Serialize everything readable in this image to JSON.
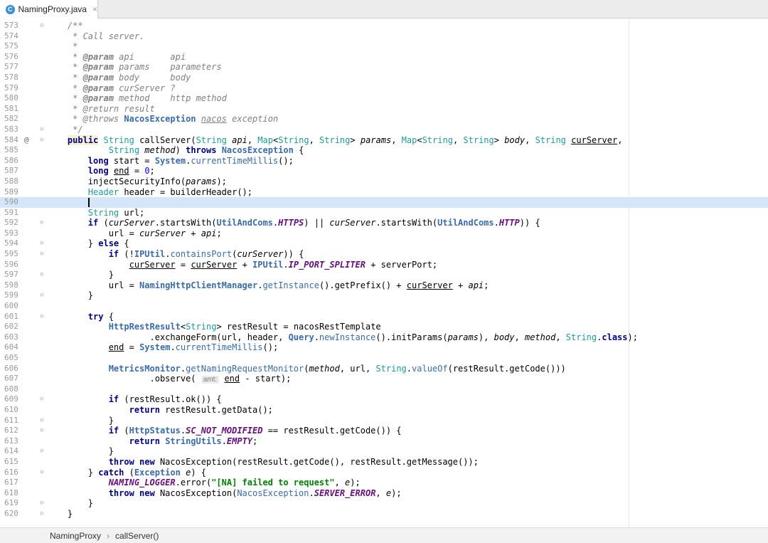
{
  "tab": {
    "filename": "NamingProxy.java",
    "icon_letter": "C",
    "close": "×"
  },
  "breadcrumb": {
    "items": [
      "NamingProxy",
      "callServer()"
    ],
    "separator": "›"
  },
  "editor": {
    "current_line": "590",
    "gutter_marker": "@"
  },
  "code_lines": [
    {
      "n": "573",
      "fold": "⊖",
      "segs": [
        [
          "",
          "    "
        ],
        [
          "cm",
          "/**"
        ]
      ]
    },
    {
      "n": "574",
      "segs": [
        [
          "cm",
          "     * Call server."
        ]
      ]
    },
    {
      "n": "575",
      "segs": [
        [
          "cm",
          "     *"
        ]
      ]
    },
    {
      "n": "576",
      "segs": [
        [
          "cm",
          "     * "
        ],
        [
          "jd",
          "@param"
        ],
        [
          "cm",
          " api       api"
        ]
      ]
    },
    {
      "n": "577",
      "segs": [
        [
          "cm",
          "     * "
        ],
        [
          "jd",
          "@param"
        ],
        [
          "cm",
          " params    parameters"
        ]
      ]
    },
    {
      "n": "578",
      "segs": [
        [
          "cm",
          "     * "
        ],
        [
          "jd",
          "@param"
        ],
        [
          "cm",
          " body      body"
        ]
      ]
    },
    {
      "n": "579",
      "segs": [
        [
          "cm",
          "     * "
        ],
        [
          "jd",
          "@param"
        ],
        [
          "cm",
          " curServer ?"
        ]
      ]
    },
    {
      "n": "580",
      "segs": [
        [
          "cm",
          "     * "
        ],
        [
          "jd",
          "@param"
        ],
        [
          "cm",
          " method    http method"
        ]
      ]
    },
    {
      "n": "581",
      "segs": [
        [
          "cm",
          "     * @return result"
        ]
      ]
    },
    {
      "n": "582",
      "segs": [
        [
          "cm",
          "     * @throws "
        ],
        [
          "cl",
          "NacosException"
        ],
        [
          "cm",
          " "
        ],
        [
          "cm ul",
          "nacos"
        ],
        [
          "cm",
          " exception"
        ]
      ]
    },
    {
      "n": "583",
      "fold": "⊖",
      "segs": [
        [
          "cm",
          "     */"
        ]
      ]
    },
    {
      "n": "584",
      "mk": "@",
      "fold": "⊖",
      "segs": [
        [
          "",
          "    "
        ],
        [
          "kw ann",
          "public"
        ],
        [
          "",
          " "
        ],
        [
          "ty",
          "String"
        ],
        [
          "",
          " callServer("
        ],
        [
          "ty",
          "String"
        ],
        [
          "",
          " "
        ],
        [
          "pa",
          "api"
        ],
        [
          "",
          ", "
        ],
        [
          "ty",
          "Map"
        ],
        [
          "",
          "<"
        ],
        [
          "ty",
          "String"
        ],
        [
          "",
          ", "
        ],
        [
          "ty",
          "String"
        ],
        [
          "",
          "> "
        ],
        [
          "pa",
          "params"
        ],
        [
          "",
          ", "
        ],
        [
          "ty",
          "Map"
        ],
        [
          "",
          "<"
        ],
        [
          "ty",
          "String"
        ],
        [
          "",
          ", "
        ],
        [
          "ty",
          "String"
        ],
        [
          "",
          "> "
        ],
        [
          "pa",
          "body"
        ],
        [
          "",
          ", "
        ],
        [
          "ty",
          "String"
        ],
        [
          "",
          " "
        ],
        [
          "ul",
          "curServer"
        ],
        [
          "",
          ","
        ]
      ]
    },
    {
      "n": "585",
      "segs": [
        [
          "",
          "            "
        ],
        [
          "ty",
          "String"
        ],
        [
          "",
          " "
        ],
        [
          "pa",
          "method"
        ],
        [
          "",
          ") "
        ],
        [
          "kw",
          "throws"
        ],
        [
          "",
          " "
        ],
        [
          "cl",
          "NacosException"
        ],
        [
          "",
          " {"
        ]
      ]
    },
    {
      "n": "586",
      "segs": [
        [
          "",
          "        "
        ],
        [
          "kw",
          "long"
        ],
        [
          "",
          " start = "
        ],
        [
          "cl",
          "System"
        ],
        [
          "",
          "."
        ],
        [
          "fn",
          "currentTimeMillis"
        ],
        [
          "",
          "();"
        ]
      ]
    },
    {
      "n": "587",
      "segs": [
        [
          "",
          "        "
        ],
        [
          "kw",
          "long"
        ],
        [
          "",
          " "
        ],
        [
          "ul",
          "end"
        ],
        [
          "",
          " = "
        ],
        [
          "num",
          "0"
        ],
        [
          "",
          ";"
        ]
      ]
    },
    {
      "n": "588",
      "segs": [
        [
          "",
          "        injectSecurityInfo("
        ],
        [
          "pa",
          "params"
        ],
        [
          "",
          ");"
        ]
      ]
    },
    {
      "n": "589",
      "segs": [
        [
          "",
          "        "
        ],
        [
          "ty",
          "Header"
        ],
        [
          "",
          " header = builderHeader();"
        ]
      ]
    },
    {
      "n": "590",
      "current": true,
      "segs": [
        [
          "",
          "        "
        ],
        [
          "cursor",
          ""
        ]
      ]
    },
    {
      "n": "591",
      "segs": [
        [
          "",
          "        "
        ],
        [
          "ty",
          "String"
        ],
        [
          "",
          " url;"
        ]
      ]
    },
    {
      "n": "592",
      "fold": "⊖",
      "segs": [
        [
          "",
          "        "
        ],
        [
          "kw",
          "if"
        ],
        [
          "",
          " ("
        ],
        [
          "pa",
          "curServer"
        ],
        [
          "",
          ".startsWith("
        ],
        [
          "cl",
          "UtilAndComs"
        ],
        [
          "",
          "."
        ],
        [
          "st",
          "HTTPS"
        ],
        [
          "",
          ") || "
        ],
        [
          "pa",
          "curServer"
        ],
        [
          "",
          ".startsWith("
        ],
        [
          "cl",
          "UtilAndComs"
        ],
        [
          "",
          "."
        ],
        [
          "st",
          "HTTP"
        ],
        [
          "",
          ")) {"
        ]
      ]
    },
    {
      "n": "593",
      "segs": [
        [
          "",
          "            url = "
        ],
        [
          "pa",
          "curServer"
        ],
        [
          "",
          " + "
        ],
        [
          "pa",
          "api"
        ],
        [
          "",
          ";"
        ]
      ]
    },
    {
      "n": "594",
      "fold": "⊖",
      "segs": [
        [
          "",
          "        } "
        ],
        [
          "kw",
          "else"
        ],
        [
          "",
          " {"
        ]
      ]
    },
    {
      "n": "595",
      "fold": "⊖",
      "segs": [
        [
          "",
          "            "
        ],
        [
          "kw",
          "if"
        ],
        [
          "",
          " (!"
        ],
        [
          "cl",
          "IPUtil"
        ],
        [
          "",
          "."
        ],
        [
          "fn",
          "containsPort"
        ],
        [
          "",
          "("
        ],
        [
          "pa",
          "curServer"
        ],
        [
          "",
          ")) {"
        ]
      ]
    },
    {
      "n": "596",
      "segs": [
        [
          "",
          "                "
        ],
        [
          "ul",
          "curServer"
        ],
        [
          "",
          " = "
        ],
        [
          "ul",
          "curServer"
        ],
        [
          "",
          " + "
        ],
        [
          "cl",
          "IPUtil"
        ],
        [
          "",
          "."
        ],
        [
          "st",
          "IP_PORT_SPLITER"
        ],
        [
          "",
          " + serverPort;"
        ]
      ]
    },
    {
      "n": "597",
      "fold": "⊖",
      "segs": [
        [
          "",
          "            }"
        ]
      ]
    },
    {
      "n": "598",
      "segs": [
        [
          "",
          "            url = "
        ],
        [
          "cl",
          "NamingHttpClientManager"
        ],
        [
          "",
          "."
        ],
        [
          "fn",
          "getInstance"
        ],
        [
          "",
          "().getPrefix() + "
        ],
        [
          "ul",
          "curServer"
        ],
        [
          "",
          " + "
        ],
        [
          "pa",
          "api"
        ],
        [
          "",
          ";"
        ]
      ]
    },
    {
      "n": "599",
      "fold": "⊖",
      "segs": [
        [
          "",
          "        }"
        ]
      ]
    },
    {
      "n": "600",
      "segs": [
        [
          "",
          ""
        ]
      ]
    },
    {
      "n": "601",
      "fold": "⊖",
      "segs": [
        [
          "",
          "        "
        ],
        [
          "kw",
          "try"
        ],
        [
          "",
          " {"
        ]
      ]
    },
    {
      "n": "602",
      "segs": [
        [
          "",
          "            "
        ],
        [
          "cl",
          "HttpRestResult"
        ],
        [
          "",
          "<"
        ],
        [
          "ty",
          "String"
        ],
        [
          "",
          "> restResult = nacosRestTemplate"
        ]
      ]
    },
    {
      "n": "603",
      "segs": [
        [
          "",
          "                    .exchangeForm(url, header, "
        ],
        [
          "cl",
          "Query"
        ],
        [
          "",
          "."
        ],
        [
          "fn",
          "newInstance"
        ],
        [
          "",
          "().initParams("
        ],
        [
          "pa",
          "params"
        ],
        [
          "",
          "), "
        ],
        [
          "pa",
          "body"
        ],
        [
          "",
          ", "
        ],
        [
          "pa",
          "method"
        ],
        [
          "",
          ", "
        ],
        [
          "ty",
          "String"
        ],
        [
          "",
          "."
        ],
        [
          "kw",
          "class"
        ],
        [
          "",
          ");"
        ]
      ]
    },
    {
      "n": "604",
      "segs": [
        [
          "",
          "            "
        ],
        [
          "ul",
          "end"
        ],
        [
          "",
          " = "
        ],
        [
          "cl",
          "System"
        ],
        [
          "",
          "."
        ],
        [
          "fn",
          "currentTimeMillis"
        ],
        [
          "",
          "();"
        ]
      ]
    },
    {
      "n": "605",
      "segs": [
        [
          "",
          ""
        ]
      ]
    },
    {
      "n": "606",
      "segs": [
        [
          "",
          "            "
        ],
        [
          "cl",
          "MetricsMonitor"
        ],
        [
          "",
          "."
        ],
        [
          "fn",
          "getNamingRequestMonitor"
        ],
        [
          "",
          "("
        ],
        [
          "pa",
          "method"
        ],
        [
          "",
          ", url, "
        ],
        [
          "ty",
          "String"
        ],
        [
          "",
          "."
        ],
        [
          "fn",
          "valueOf"
        ],
        [
          "",
          "(restResult.getCode()))"
        ]
      ]
    },
    {
      "n": "607",
      "segs": [
        [
          "",
          "                    .observe( "
        ],
        [
          "hint",
          "amt:"
        ],
        [
          "",
          " "
        ],
        [
          "ul",
          "end"
        ],
        [
          "",
          " - start);"
        ]
      ]
    },
    {
      "n": "608",
      "segs": [
        [
          "",
          ""
        ]
      ]
    },
    {
      "n": "609",
      "fold": "⊖",
      "segs": [
        [
          "",
          "            "
        ],
        [
          "kw",
          "if"
        ],
        [
          "",
          " (restResult.ok()) {"
        ]
      ]
    },
    {
      "n": "610",
      "segs": [
        [
          "",
          "                "
        ],
        [
          "kw",
          "return"
        ],
        [
          "",
          " restResult.getData();"
        ]
      ]
    },
    {
      "n": "611",
      "fold": "⊖",
      "segs": [
        [
          "",
          "            }"
        ]
      ]
    },
    {
      "n": "612",
      "fold": "⊖",
      "segs": [
        [
          "",
          "            "
        ],
        [
          "kw",
          "if"
        ],
        [
          "",
          " ("
        ],
        [
          "cl",
          "HttpStatus"
        ],
        [
          "",
          "."
        ],
        [
          "st",
          "SC_NOT_MODIFIED"
        ],
        [
          "",
          " == restResult.getCode()) {"
        ]
      ]
    },
    {
      "n": "613",
      "segs": [
        [
          "",
          "                "
        ],
        [
          "kw",
          "return"
        ],
        [
          "",
          " "
        ],
        [
          "cl",
          "StringUtils"
        ],
        [
          "",
          "."
        ],
        [
          "st",
          "EMPTY"
        ],
        [
          "",
          ";"
        ]
      ]
    },
    {
      "n": "614",
      "fold": "⊖",
      "segs": [
        [
          "",
          "            }"
        ]
      ]
    },
    {
      "n": "615",
      "segs": [
        [
          "",
          "            "
        ],
        [
          "kw",
          "throw new"
        ],
        [
          "",
          " NacosException(restResult.getCode(), restResult.getMessage());"
        ]
      ]
    },
    {
      "n": "616",
      "fold": "⊖",
      "segs": [
        [
          "",
          "        } "
        ],
        [
          "kw",
          "catch"
        ],
        [
          "",
          " ("
        ],
        [
          "cl",
          "Exception"
        ],
        [
          "",
          " "
        ],
        [
          "pa",
          "e"
        ],
        [
          "",
          ") {"
        ]
      ]
    },
    {
      "n": "617",
      "segs": [
        [
          "",
          "            "
        ],
        [
          "st",
          "NAMING_LOGGER"
        ],
        [
          "",
          ".error("
        ],
        [
          "str",
          "\"[NA] failed to request\""
        ],
        [
          "",
          ", "
        ],
        [
          "pa",
          "e"
        ],
        [
          "",
          ");"
        ]
      ]
    },
    {
      "n": "618",
      "segs": [
        [
          "",
          "            "
        ],
        [
          "kw",
          "throw new"
        ],
        [
          "",
          " NacosException("
        ],
        [
          "fn",
          "NacosException"
        ],
        [
          "",
          "."
        ],
        [
          "st",
          "SERVER_ERROR"
        ],
        [
          "",
          ", "
        ],
        [
          "pa",
          "e"
        ],
        [
          "",
          ");"
        ]
      ]
    },
    {
      "n": "619",
      "fold": "⊖",
      "segs": [
        [
          "",
          "        }"
        ]
      ]
    },
    {
      "n": "620",
      "fold": "⊖",
      "segs": [
        [
          "",
          "    }"
        ]
      ]
    }
  ]
}
